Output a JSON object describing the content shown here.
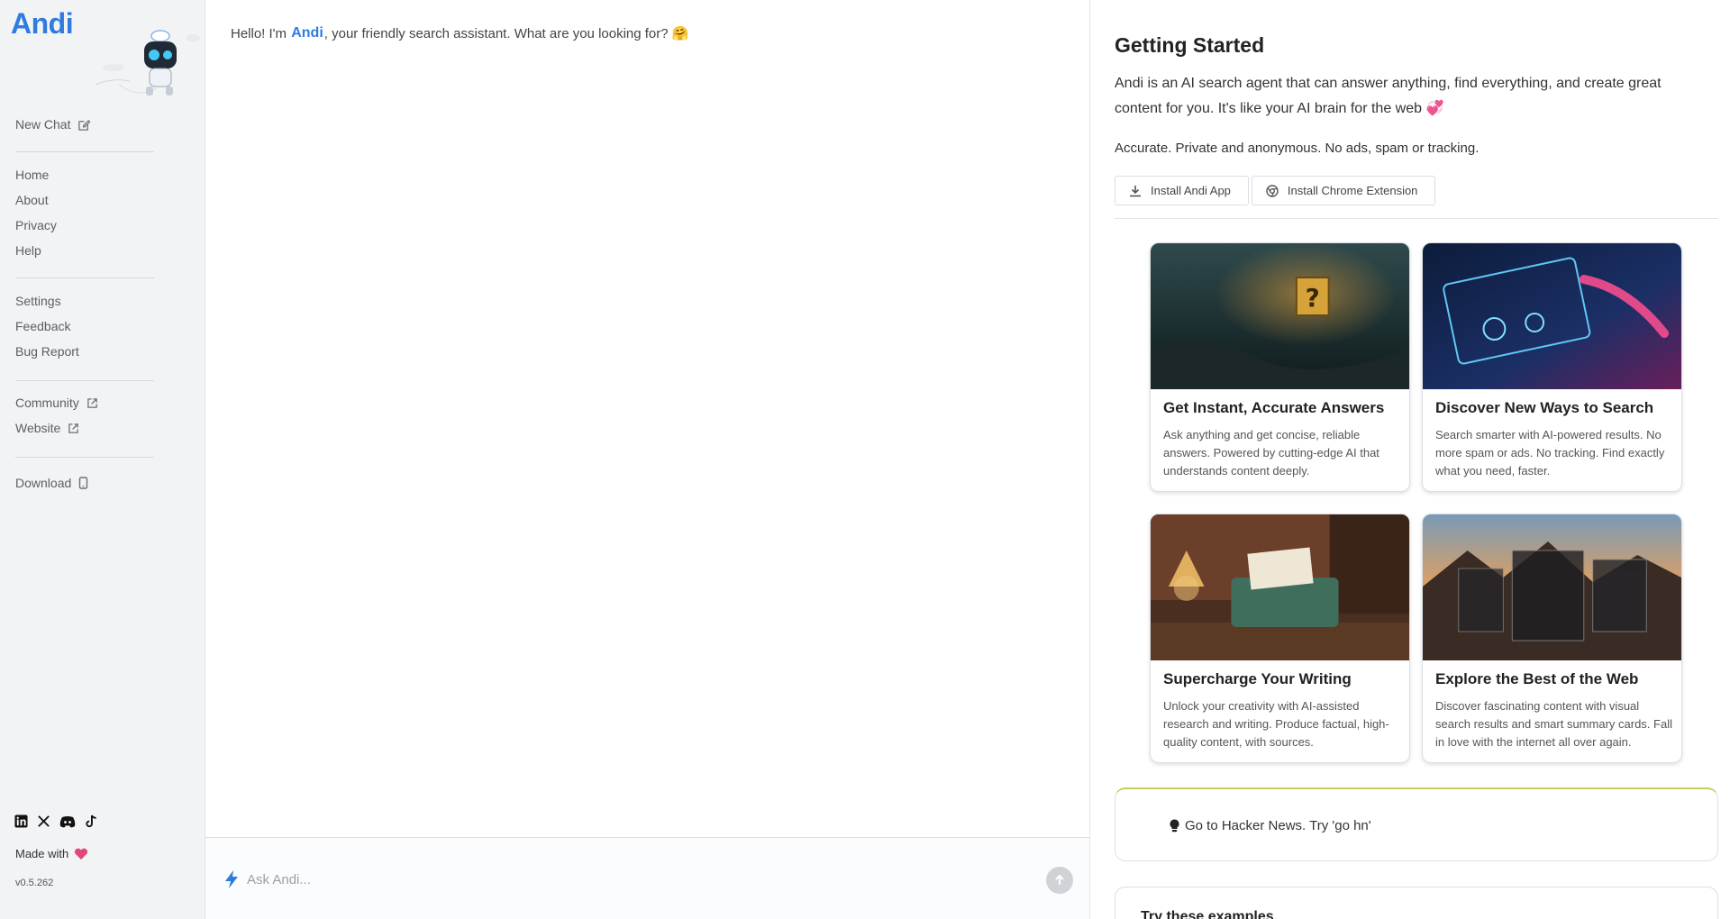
{
  "app": {
    "logo": "Andi",
    "version": "v0.5.262",
    "made_with": "Made with"
  },
  "sidebar": {
    "new_chat": "New Chat",
    "group1": [
      "Home",
      "About",
      "Privacy",
      "Help"
    ],
    "group2": [
      "Settings",
      "Feedback",
      "Bug Report"
    ],
    "community": "Community",
    "website": "Website",
    "download": "Download",
    "socials": [
      "linkedin-icon",
      "x-icon",
      "discord-icon",
      "tiktok-icon"
    ]
  },
  "chat": {
    "greeting_pre": "Hello! I'm",
    "greeting_brand": "Andi",
    "greeting_post": ", your friendly search assistant. What are you looking for?",
    "greeting_emoji": "🤗",
    "input_placeholder": "Ask Andi..."
  },
  "panel": {
    "title": "Getting Started",
    "description": "Andi is an AI search agent that can answer anything, find everything, and create great content for you. It's like your AI brain for the web 💞",
    "tagline": "Accurate. Private and anonymous. No ads, spam or tracking.",
    "install_app": "Install Andi App",
    "install_extension": "Install Chrome Extension",
    "cards": [
      {
        "title": "Get Instant, Accurate Answers",
        "text": "Ask anything and get concise, reliable answers. Powered by cutting-edge AI that understands content deeply."
      },
      {
        "title": "Discover New Ways to Search",
        "text": "Search smarter with AI-powered results. No more spam or ads. No tracking. Find exactly what you need, faster."
      },
      {
        "title": "Supercharge Your Writing",
        "text": "Unlock your creativity with AI-assisted research and writing. Produce factual, high-quality content, with sources."
      },
      {
        "title": "Explore the Best of the Web",
        "text": "Discover fascinating content with visual search results and smart summary cards. Fall in love with the internet all over again."
      }
    ],
    "tip": "Go to Hacker News. Try 'go hn'",
    "examples_title": "Try these examples"
  },
  "colors": {
    "brand": "#2f7ce0",
    "heart": "#e5467a",
    "tip_border": "#c9cf5a"
  }
}
